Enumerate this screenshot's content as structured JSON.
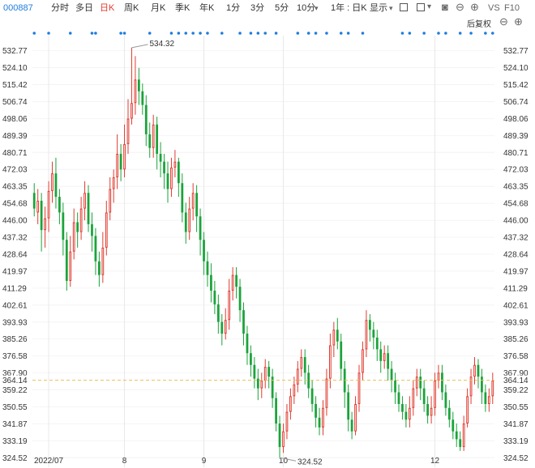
{
  "toolbar": {
    "code": "000887",
    "periods": [
      "分时",
      "多日",
      "日K",
      "周K",
      "月K",
      "季K",
      "年K",
      "1分",
      "3分",
      "5分",
      "10分"
    ],
    "active_period": "日K",
    "range_select": "1年 : 日K",
    "display_label": "显示",
    "vs_label": "VS",
    "f10_label": "F10",
    "adjust_label": "后复权"
  },
  "icons": {
    "settings": "settings-icon",
    "camera": "camera-icon",
    "zoom_out": "zoom-out-icon",
    "zoom_in": "zoom-in-icon",
    "minus": "minus-icon",
    "plus": "plus-icon"
  },
  "chart_data": {
    "type": "candlestick",
    "y_ticks": [
      "532.77",
      "524.10",
      "515.42",
      "506.74",
      "498.06",
      "489.39",
      "480.71",
      "472.03",
      "463.35",
      "454.68",
      "446.00",
      "437.32",
      "428.64",
      "419.97",
      "411.29",
      "402.61",
      "393.93",
      "385.26",
      "376.58",
      "367.90",
      "359.22",
      "350.55",
      "341.87",
      "333.19",
      "324.52"
    ],
    "ylim": [
      320.5,
      538
    ],
    "x_ticks": [
      {
        "label": "2022/07",
        "index": 4
      },
      {
        "label": "8",
        "index": 25
      },
      {
        "label": "9",
        "index": 47
      },
      {
        "label": "10",
        "index": 69
      },
      {
        "label": "12",
        "index": 111
      }
    ],
    "current_price": "364.14",
    "high_label": "534.32",
    "low_label": "324.52",
    "high_index": 27,
    "low_index": 68,
    "colors": {
      "up": "#e03c31",
      "down": "#1aa33a",
      "dot": "#1e7ce0",
      "current": "#e6c15a"
    },
    "marker_indices": [
      0,
      4,
      10,
      16,
      17,
      24,
      25,
      32,
      38,
      40,
      42,
      44,
      46,
      48,
      52,
      57,
      60,
      62,
      64,
      67,
      73,
      76,
      78,
      81,
      85,
      87,
      91,
      102,
      104,
      108,
      112,
      114,
      118,
      121,
      125,
      127
    ],
    "candles": [
      [
        460,
        452,
        465,
        448
      ],
      [
        450,
        456,
        462,
        444
      ],
      [
        456,
        441,
        460,
        430
      ],
      [
        441,
        447,
        453,
        432
      ],
      [
        447,
        461,
        466,
        440
      ],
      [
        461,
        470,
        476,
        455
      ],
      [
        470,
        458,
        478,
        452
      ],
      [
        458,
        450,
        462,
        444
      ],
      [
        450,
        436,
        455,
        428
      ],
      [
        436,
        415,
        440,
        410
      ],
      [
        415,
        430,
        438,
        412
      ],
      [
        430,
        445,
        452,
        426
      ],
      [
        445,
        440,
        450,
        432
      ],
      [
        440,
        452,
        458,
        436
      ],
      [
        452,
        460,
        466,
        446
      ],
      [
        460,
        444,
        464,
        440
      ],
      [
        444,
        438,
        450,
        430
      ],
      [
        438,
        425,
        442,
        418
      ],
      [
        425,
        418,
        430,
        412
      ],
      [
        418,
        432,
        440,
        414
      ],
      [
        432,
        450,
        456,
        428
      ],
      [
        450,
        462,
        468,
        446
      ],
      [
        462,
        468,
        472,
        455
      ],
      [
        468,
        480,
        490,
        462
      ],
      [
        480,
        472,
        485,
        466
      ],
      [
        472,
        485,
        495,
        468
      ],
      [
        485,
        498,
        508,
        480
      ],
      [
        498,
        506,
        534.32,
        495
      ],
      [
        506,
        518,
        530,
        500
      ],
      [
        518,
        512,
        524,
        505
      ],
      [
        512,
        505,
        516,
        500
      ],
      [
        505,
        490,
        510,
        484
      ],
      [
        490,
        483,
        496,
        478
      ],
      [
        483,
        495,
        500,
        478
      ],
      [
        495,
        480,
        499,
        472
      ],
      [
        480,
        476,
        486,
        468
      ],
      [
        476,
        470,
        480,
        462
      ],
      [
        470,
        462,
        476,
        455
      ],
      [
        462,
        473,
        478,
        458
      ],
      [
        473,
        476,
        482,
        468
      ],
      [
        476,
        465,
        478,
        458
      ],
      [
        465,
        450,
        470,
        445
      ],
      [
        450,
        440,
        455,
        434
      ],
      [
        440,
        452,
        458,
        436
      ],
      [
        452,
        460,
        465,
        446
      ],
      [
        460,
        448,
        464,
        440
      ],
      [
        448,
        436,
        452,
        428
      ],
      [
        436,
        425,
        440,
        418
      ],
      [
        425,
        418,
        430,
        412
      ],
      [
        418,
        410,
        424,
        404
      ],
      [
        410,
        403,
        415,
        398
      ],
      [
        403,
        394,
        408,
        388
      ],
      [
        394,
        388,
        398,
        382
      ],
      [
        388,
        395,
        401,
        385
      ],
      [
        395,
        410,
        416,
        390
      ],
      [
        410,
        418,
        422,
        405
      ],
      [
        418,
        412,
        422,
        406
      ],
      [
        412,
        400,
        416,
        394
      ],
      [
        400,
        388,
        404,
        382
      ],
      [
        388,
        378,
        392,
        372
      ],
      [
        378,
        372,
        382,
        366
      ],
      [
        372,
        365,
        376,
        360
      ],
      [
        365,
        360,
        370,
        354
      ],
      [
        360,
        364,
        368,
        355
      ],
      [
        364,
        371,
        375,
        360
      ],
      [
        371,
        366,
        374,
        360
      ],
      [
        366,
        355,
        370,
        350
      ],
      [
        355,
        342,
        358,
        338
      ],
      [
        342,
        330,
        346,
        324.52
      ],
      [
        330,
        338,
        342,
        327
      ],
      [
        338,
        348,
        352,
        334
      ],
      [
        348,
        356,
        360,
        344
      ],
      [
        356,
        362,
        366,
        352
      ],
      [
        362,
        370,
        374,
        358
      ],
      [
        370,
        376,
        380,
        366
      ],
      [
        376,
        368,
        380,
        362
      ],
      [
        368,
        360,
        372,
        355
      ],
      [
        360,
        352,
        364,
        348
      ],
      [
        352,
        345,
        356,
        340
      ],
      [
        345,
        340,
        350,
        336
      ],
      [
        340,
        350,
        354,
        336
      ],
      [
        350,
        365,
        370,
        346
      ],
      [
        365,
        382,
        388,
        360
      ],
      [
        382,
        390,
        394,
        376
      ],
      [
        390,
        384,
        396,
        380
      ],
      [
        384,
        370,
        388,
        364
      ],
      [
        370,
        358,
        374,
        350
      ],
      [
        358,
        344,
        362,
        338
      ],
      [
        344,
        338,
        348,
        334
      ],
      [
        338,
        352,
        356,
        336
      ],
      [
        352,
        368,
        372,
        348
      ],
      [
        368,
        380,
        384,
        364
      ],
      [
        380,
        395,
        400,
        376
      ],
      [
        395,
        390,
        398,
        384
      ],
      [
        390,
        386,
        394,
        380
      ],
      [
        386,
        380,
        390,
        374
      ],
      [
        380,
        374,
        384,
        368
      ],
      [
        374,
        378,
        382,
        370
      ],
      [
        378,
        370,
        382,
        364
      ],
      [
        370,
        364,
        374,
        358
      ],
      [
        364,
        358,
        368,
        352
      ],
      [
        358,
        352,
        362,
        348
      ],
      [
        352,
        348,
        356,
        344
      ],
      [
        348,
        344,
        352,
        340
      ],
      [
        344,
        350,
        356,
        340
      ],
      [
        350,
        360,
        364,
        346
      ],
      [
        360,
        366,
        370,
        356
      ],
      [
        366,
        360,
        370,
        354
      ],
      [
        360,
        352,
        364,
        348
      ],
      [
        352,
        346,
        356,
        342
      ],
      [
        346,
        350,
        356,
        342
      ],
      [
        350,
        364,
        368,
        346
      ],
      [
        364,
        368,
        372,
        360
      ],
      [
        368,
        358,
        372,
        354
      ],
      [
        358,
        350,
        362,
        346
      ],
      [
        350,
        344,
        354,
        340
      ],
      [
        344,
        338,
        348,
        334
      ],
      [
        338,
        334,
        342,
        330
      ],
      [
        334,
        330,
        338,
        328
      ],
      [
        330,
        342,
        346,
        328
      ],
      [
        342,
        356,
        360,
        340
      ],
      [
        356,
        366,
        370,
        352
      ],
      [
        366,
        372,
        376,
        362
      ],
      [
        372,
        366,
        375,
        360
      ],
      [
        366,
        358,
        370,
        352
      ],
      [
        358,
        352,
        362,
        348
      ],
      [
        352,
        356,
        360,
        348
      ],
      [
        356,
        364,
        368,
        352
      ]
    ]
  }
}
